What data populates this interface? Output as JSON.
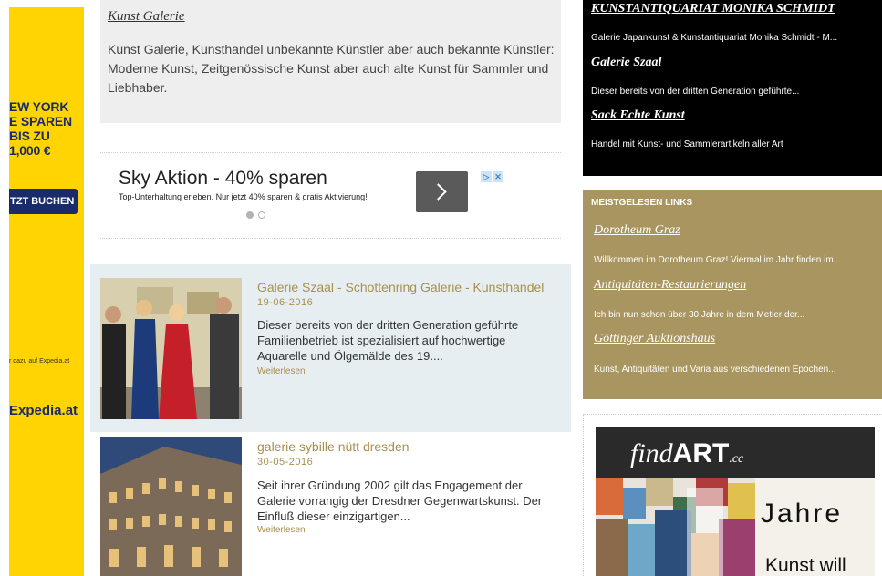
{
  "left_ad": {
    "promo_lines": "EW YORK\nE SPAREN\n BIS ZU\n1,000 €",
    "button_label": "TZT BUCHEN",
    "fine_print": "r dazu auf Expedia.at",
    "logo": "Expedia.at"
  },
  "kunst_galerie": {
    "title": "Kunst Galerie",
    "text": "Kunst Galerie, Kunsthandel unbekannte Künstler aber auch bekannte Künstler: Moderne Kunst, Zeitgenössische Kunst aber auch alte Kunst für Sammler und Liebhaber."
  },
  "inline_ad": {
    "title": "Sky Aktion - 40% sparen",
    "subtitle": "Top-Unterhaltung erleben. Nur jetzt 40% sparen & gratis Aktivierung!",
    "adchoice_glyphs": [
      "▷",
      "✕"
    ],
    "dot_colors": [
      "#b3b3b3",
      "#ffffff"
    ]
  },
  "articles": [
    {
      "title": "Galerie Szaal - Schottenring Galerie - Kunsthandel",
      "date": "19-06-2016",
      "excerpt": "Dieser bereits von der dritten Generation geführte Familienbetrieb ist spezialisiert auf hochwertige Aquarelle und Ölgemälde des 19....",
      "more": "Weiterlesen"
    },
    {
      "title": "galerie sybille nütt dresden",
      "date": "30-05-2016",
      "excerpt": "Seit ihrer Gründung 2002 gilt das Engagement der Galerie vorrangig der Dresdner Gegenwartskunst. Der Einfluß dieser einzigartigen...",
      "more": "Weiterlesen"
    }
  ],
  "sidebar_black": {
    "items": [
      {
        "title": "KUNSTANTIQUARIAT MONIKA SCHMIDT",
        "desc": "Galerie Japankunst & Kunstantiquariat Monika Schmidt - M..."
      },
      {
        "title": "Galerie Szaal",
        "desc": "Dieser bereits von der dritten Generation geführte..."
      },
      {
        "title": "Sack Echte Kunst",
        "desc": "Handel mit Kunst- und Sammlerartikeln aller Art"
      }
    ]
  },
  "sidebar_popular": {
    "header": "MEISTGELESEN LINKS",
    "items": [
      {
        "title": "Dorotheum Graz",
        "desc": "Willkommen im Dorotheum Graz! Viermal im Jahr finden im..."
      },
      {
        "title": "Antiquitäten-Restaurierungen",
        "desc": "Ich bin nun schon über 30 Jahre in dem Metier der..."
      },
      {
        "title": "Göttinger Auktionshaus",
        "desc": "Kunst, Antiquitäten und Varia aus verschiedenen Epochen..."
      }
    ]
  },
  "findart_banner": {
    "logo_a": "find",
    "logo_b": "ART",
    "logo_c": ".cc",
    "jahre": "Jahre",
    "kunst": "Kunst will"
  },
  "colors": {
    "gold": "#a89560",
    "link_gold": "#a98f4d",
    "ad_yellow": "#ffd400",
    "ad_blue": "#1a2b6b"
  }
}
